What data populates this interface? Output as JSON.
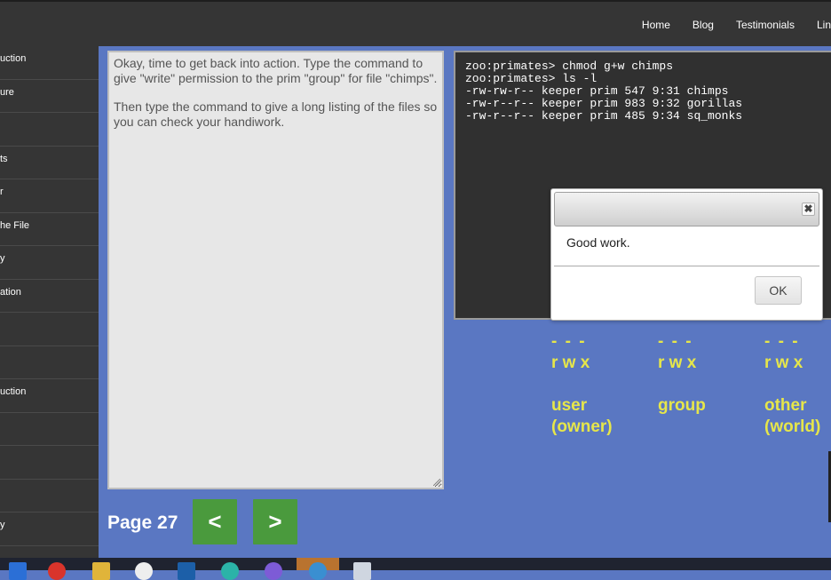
{
  "nav": {
    "items": [
      "Home",
      "Blog",
      "Testimonials",
      "Lin"
    ]
  },
  "sidebar": {
    "items": [
      "uction",
      "ure",
      "",
      "ts",
      "r",
      "he File",
      "y",
      "ation",
      "",
      "",
      "uction",
      "",
      "",
      "",
      "y",
      ""
    ]
  },
  "lesson": {
    "paragraph1": "Okay, time to get back into action. Type the command to give \"write\" permission to the prim \"group\" for file \"chimps\".",
    "paragraph2": "Then type the command to give a long listing of the files so you can check your handiwork."
  },
  "terminal": {
    "lines": [
      "zoo:primates> chmod g+w chimps",
      "zoo:primates> ls -l",
      "-rw-rw-r-- keeper prim 547 9:31 chimps",
      "-rw-r--r-- keeper prim 983 9:32 gorillas",
      "-rw-r--r-- keeper prim 485 9:34 sq_monks"
    ]
  },
  "dialog": {
    "close_glyph": "✖",
    "message": "Good work.",
    "ok_label": "OK"
  },
  "permissions": [
    {
      "dashes": "- - -",
      "bits": "r w x",
      "line1": "user",
      "line2": "(owner)"
    },
    {
      "dashes": "- - -",
      "bits": "r w x",
      "line1": "group",
      "line2": ""
    },
    {
      "dashes": "- - -",
      "bits": "r w x",
      "line1": "other",
      "line2": "(world)"
    }
  ],
  "pager": {
    "page_label": "Page 27",
    "prev_label": "<",
    "next_label": ">"
  },
  "colors": {
    "background": "#5a77c2",
    "sidebar": "#353535",
    "accent_button": "#4a9a3d",
    "permission_text": "#e6e64a"
  },
  "taskbar": {
    "icons": [
      "windows-icon",
      "chrome-icon",
      "folder-icon",
      "search-icon",
      "store-icon",
      "app-icon",
      "viber-icon",
      "browser-icon",
      "file-icon"
    ]
  }
}
